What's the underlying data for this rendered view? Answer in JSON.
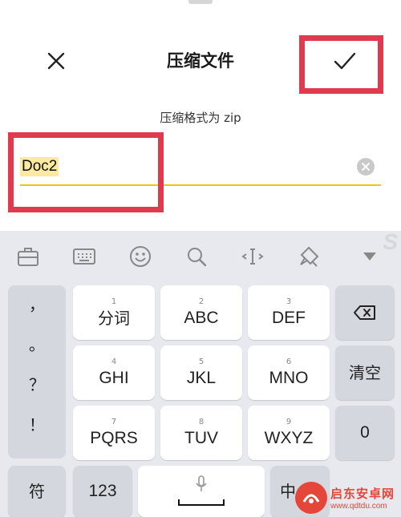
{
  "dialog": {
    "title": "压缩文件",
    "subtitle": "压缩格式为 zip",
    "close_icon": "close-icon",
    "confirm_icon": "check-icon"
  },
  "file_name": {
    "value": "Doc2",
    "clear_icon": "clear-icon"
  },
  "highlight_color": "#e03a4e",
  "input_underline_color": "#f0c419",
  "keyboard": {
    "toolbar_icons": [
      "briefcase-icon",
      "keyboard-icon",
      "emoji-icon",
      "search-icon",
      "cursor-move-icon",
      "brush-icon",
      "collapse-icon"
    ],
    "punctuation": [
      "，",
      "。",
      "？",
      "！"
    ],
    "rows": [
      [
        {
          "num": "1",
          "label": "分词"
        },
        {
          "num": "2",
          "label": "ABC"
        },
        {
          "num": "3",
          "label": "DEF"
        }
      ],
      [
        {
          "num": "4",
          "label": "GHI"
        },
        {
          "num": "5",
          "label": "JKL"
        },
        {
          "num": "6",
          "label": "MNO"
        }
      ],
      [
        {
          "num": "7",
          "label": "PQRS"
        },
        {
          "num": "8",
          "label": "TUV"
        },
        {
          "num": "9",
          "label": "WXYZ"
        }
      ]
    ],
    "right_keys": {
      "delete_icon": "backspace-icon",
      "clear": "清空",
      "zero": "0"
    },
    "bottom_row": {
      "symbols": "符",
      "numbers": "123",
      "space_icon": "microphone-icon",
      "lang": "中"
    }
  },
  "watermark": {
    "name": "启东安卓网",
    "url": "www.qdtdu.com"
  }
}
